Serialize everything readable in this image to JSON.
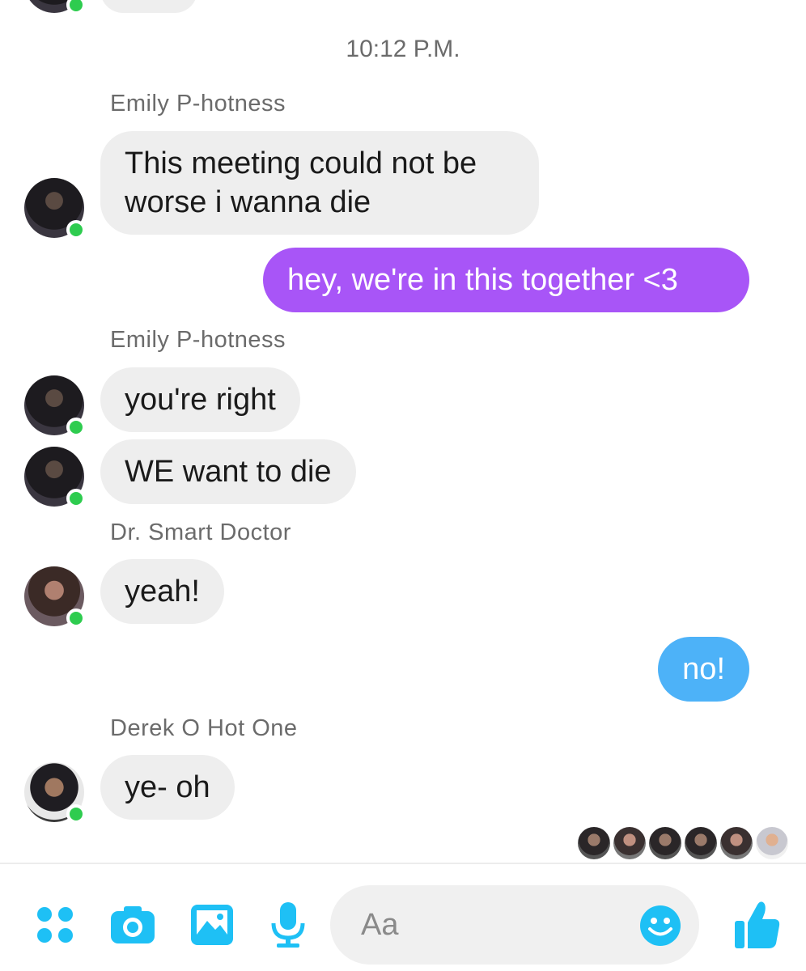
{
  "timestamp": "10:12 P.M.",
  "messages": [
    {
      "sender": "Emily P-hotness",
      "text": "This meeting could not be worse i wanna die"
    },
    {
      "text": "hey, we're in this together <3"
    },
    {
      "sender": "Emily P-hotness",
      "text": "you're right"
    },
    {
      "text": "WE want to die"
    },
    {
      "sender": "Dr. Smart Doctor",
      "text": "yeah!"
    },
    {
      "text": "no!"
    },
    {
      "sender": "Derek O Hot One",
      "text": "ye- oh"
    }
  ],
  "composer": {
    "placeholder": "Aa"
  },
  "icons": [
    "more-apps-icon",
    "camera-icon",
    "gallery-icon",
    "microphone-icon",
    "emoji-icon",
    "thumbs-up-icon"
  ],
  "colors": {
    "accent": "#1ec0f5",
    "outgoing_purple": "#a855f7",
    "outgoing_blue": "#4db2f8",
    "incoming_gray": "#eeeeee",
    "online": "#2ecc4f"
  }
}
